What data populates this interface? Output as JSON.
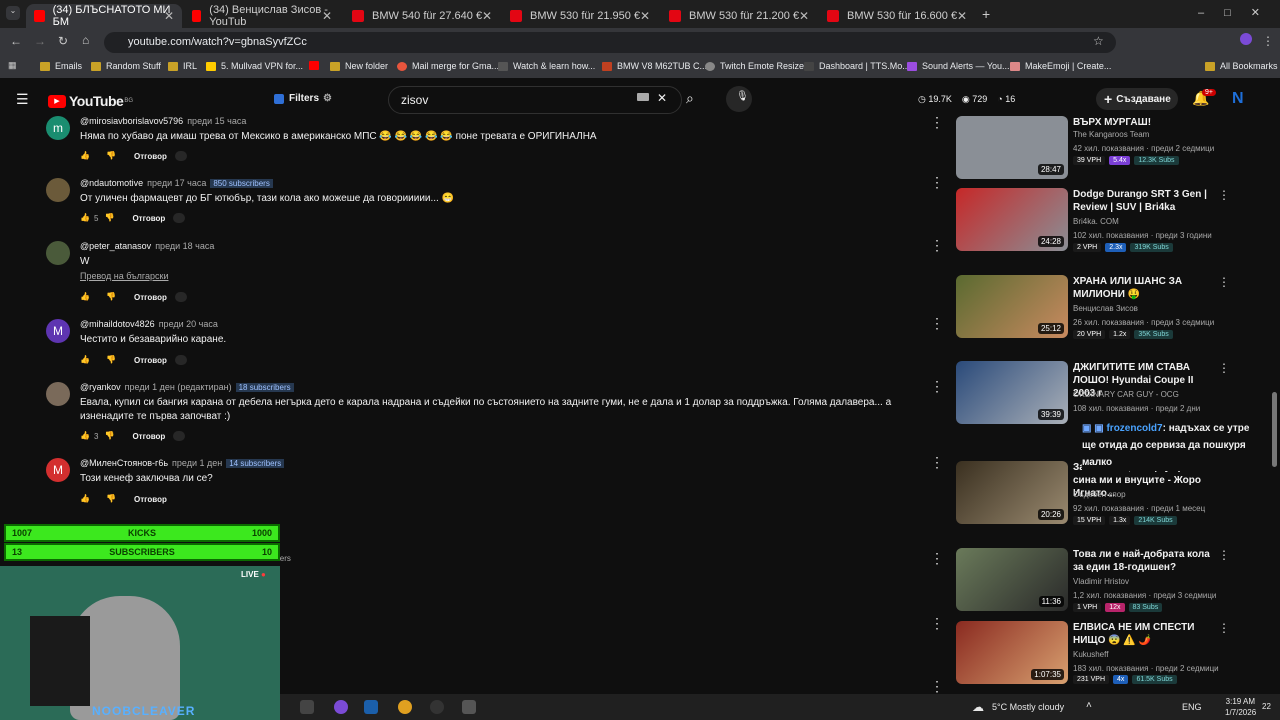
{
  "tabs": [
    {
      "label": "(34) БЛЪСНАТОТО МИ БМ",
      "color": "#ff0000"
    },
    {
      "label": "(34) Венцислав Зисов - YouTub",
      "color": "#ff0000"
    },
    {
      "label": "BMW 540 für 27.640 €",
      "color": "#e30613"
    },
    {
      "label": "BMW 530 für 21.950 €",
      "color": "#e30613"
    },
    {
      "label": "BMW 530 für 21.200 €",
      "color": "#e30613"
    },
    {
      "label": "BMW 530 für 16.600 €",
      "color": "#e30613"
    }
  ],
  "url": "youtube.com/watch?v=gbnaSyvfZCc",
  "bookmarks": [
    "Emails",
    "Random Stuff",
    "IRL",
    "5. Mullvad VPN for...",
    "",
    "New folder",
    "Mail merge for Gma...",
    "Watch & learn how...",
    "BMW V8 M62TUB C...",
    "Twitch Emote Resizer",
    "Dashboard | TTS.Mo...",
    "Sound Alerts — You...",
    "MakeEmoji | Create...",
    "All Bookmarks"
  ],
  "yt": {
    "logo": "YouTube",
    "region": "BG",
    "filters": "Filters",
    "search": "zisov",
    "stats": {
      "views": "19.7K",
      "watching": "729",
      "count": "16"
    },
    "create": "Създаване",
    "notif": "9+",
    "avatar": "N"
  },
  "comments": [
    {
      "user": "@mirosiavborislavov5796",
      "time": "преди 15 часа",
      "subs": "",
      "text": "Няма по хубаво да имаш трева от Мексико в американско МПС 😂 😂 😂 😂 😂 поне тревата е ОРИГИНАЛНА",
      "likes": "",
      "reply": "Отговор",
      "avatar": "m",
      "avcolor": "#1a8d70"
    },
    {
      "user": "@ndautomotive",
      "time": "преди 17 часа",
      "subs": "850 subscribers",
      "text": "От уличен фармацевт до БГ ютюбър, тази кола ако можеше да говориииии... 😁",
      "likes": "5",
      "reply": "Отговор",
      "avatar": "",
      "avcolor": "#6b5a3a"
    },
    {
      "user": "@peter_atanasov",
      "time": "преди 18 часа",
      "subs": "",
      "text": "W",
      "translate": "Превод на български",
      "likes": "",
      "reply": "Отговор",
      "avatar": "",
      "avcolor": "#4a5a3a"
    },
    {
      "user": "@mihaildotov4826",
      "time": "преди 20 часа",
      "subs": "",
      "text": "Честито и безаварийно каране.",
      "likes": "",
      "reply": "Отговор",
      "avatar": "M",
      "avcolor": "#5e35b1"
    },
    {
      "user": "@ryankov",
      "time": "преди 1 ден (редактиран)",
      "subs": "18 subscribers",
      "text": "Евала, купил си бангия карана от дебела негърка дето е карала надрана и съдейки по състоянието на задните гуми, не е дала и 1 долар за поддръжка. Голяма далавера... а изненадите те първа започват :)",
      "likes": "3",
      "reply": "Отговор",
      "avatar": "",
      "avcolor": "#7a6a5a"
    },
    {
      "user": "@МиленСтоянов-г6ь",
      "time": "преди 1 ден",
      "subs": "14 subscribers",
      "text": "Този кенеф заключва ли се?",
      "likes": "",
      "reply": "Отговор",
      "avatar": "M",
      "avcolor": "#d32f2f"
    }
  ],
  "recs": [
    {
      "title": "ВЪРХ МУРГАШ!",
      "channel": "The Kangaroos Team",
      "views": "42 хил. показвания · преди 2 седмици",
      "duration": "28:47",
      "vph": "39 VPH",
      "mult": "5.4x",
      "subsc": "12.3K Subs",
      "thumb": "#8a8f96"
    },
    {
      "title": "Dodge Durango SRT 3 Gen | Review | SUV | Bri4ka",
      "channel": "Bri4ka. COM",
      "views": "102 хил. показвания · преди 3 години",
      "duration": "24:28",
      "vph": "2 VPH",
      "mult": "2.3x",
      "subsc": "319K Subs",
      "thumb": "#b8252e"
    },
    {
      "title": "ХРАНА ИЛИ ШАНС ЗА МИЛИОНИ 🤑",
      "channel": "Венцислав Зисов",
      "views": "26 хил. показвания · преди 3 седмици",
      "duration": "25:12",
      "vph": "20 VPH",
      "mult": "1.2x",
      "subsc": "35K Subs",
      "thumb": "#4a5a2a"
    },
    {
      "title": "ДЖИГИТИТЕ ИМ СТАВА ЛОШО! Hyundai Coupe II 2003 г",
      "channel": "ORDINARY CAR GUY - OCG",
      "views": "108 хил. показвания · преди 2 дни",
      "duration": "39:39",
      "vph": "",
      "mult": "",
      "subsc": "",
      "thumb": "#5a7a8a"
    },
    {
      "title": "Заклаха ли, че ще умре сина ми и внуците - Жоро Игнато...",
      "channel": "Съдебен спор",
      "views": "92 хил. показвания · преди 1 месец",
      "duration": "20:26",
      "vph": "15 VPH",
      "mult": "1.3x",
      "subsc": "214K Subs",
      "thumb": "#3a3020"
    },
    {
      "title": "Това ли е най-добрата кола за един 18-годишен?",
      "channel": "Vladimir Hristov",
      "views": "1,2 хил. показвания · преди 3 седмици",
      "duration": "11:36",
      "vph": "1 VPH",
      "mult": "12x",
      "subsc": "83 Subs",
      "thumb": "#6a7a5a"
    },
    {
      "title": "ЕЛВИСА НЕ ИМ СПЕСТИ НИЩО 😨 ⚠️ 🌶️",
      "channel": "Kukusheff",
      "views": "183 хил. показвания · преди 2 седмици",
      "duration": "1:07:35",
      "vph": "231 VPH",
      "mult": "4x",
      "subsc": "61.5K Subs",
      "thumb": "#8a2a20"
    }
  ],
  "chat": {
    "user": "frozencold7",
    "text": ": надъхах се утре ще отида до сервиза да пошкуря малко"
  },
  "overlay": {
    "kicks_label": "KICKS",
    "kicks_left": "1007",
    "kicks_right": "1000",
    "subs_label": "SUBSCRIBERS",
    "subs_left": "13",
    "subs_right": "10",
    "live": "LIVE",
    "name": "NOOBCLEAVER",
    "hidden_subs": "subscribers"
  },
  "taskbar": {
    "weather": "5°C Mostly cloudy",
    "lang": "ENG",
    "time": "3:19 AM",
    "date": "1/7/2026",
    "notif": "22"
  }
}
